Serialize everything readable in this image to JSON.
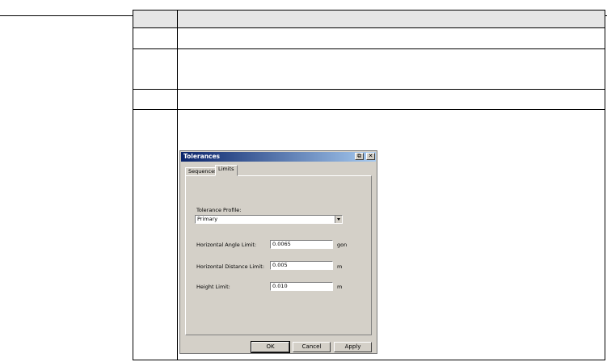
{
  "dialog": {
    "title": "Tolerances",
    "restore_glyph": "⧉",
    "close_glyph": "✕",
    "tabs": [
      {
        "label": "Sequences"
      },
      {
        "label": "Limits"
      }
    ],
    "profile_label": "Tolerance Profile:",
    "profile_value": "Primary",
    "fields": [
      {
        "label": "Horizontal Angle Limit:",
        "value": "0.0065",
        "unit": "gon"
      },
      {
        "label": "Horizontal Distance Limit:",
        "value": "0.005",
        "unit": "m"
      },
      {
        "label": "Height Limit:",
        "value": "0.010",
        "unit": "m"
      }
    ],
    "buttons": {
      "ok": "OK",
      "cancel": "Cancel",
      "apply": "Apply"
    }
  }
}
